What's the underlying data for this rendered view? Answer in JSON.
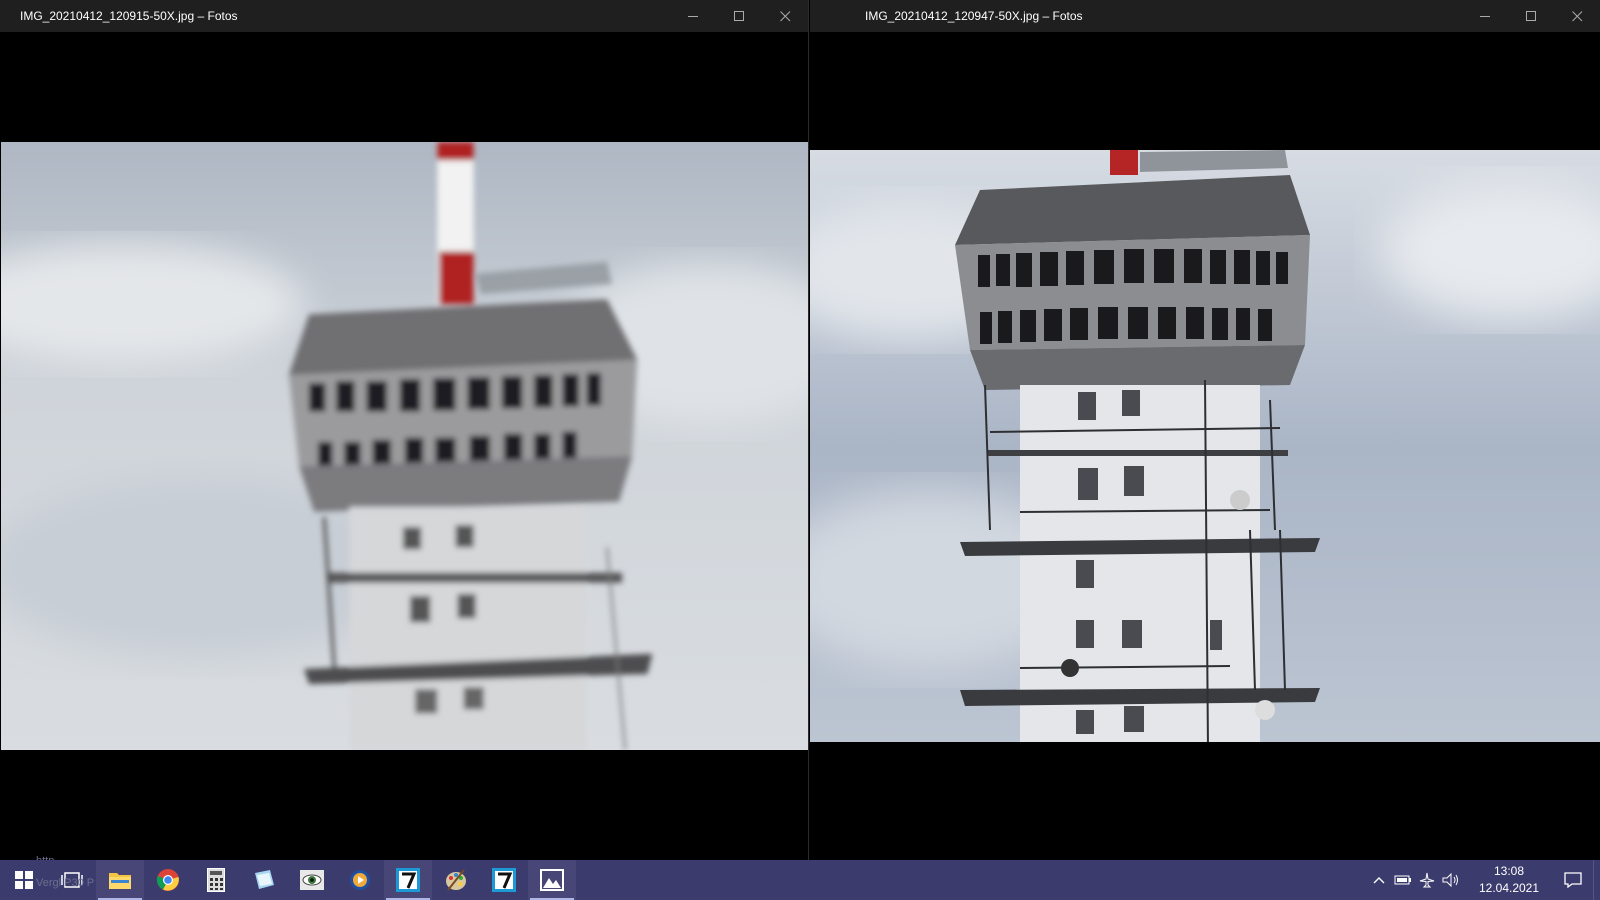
{
  "windows": {
    "left": {
      "title": "IMG_20210412_120915-50X.jpg – Fotos",
      "photo_alt": "blurry zoomed photo of a concrete TV tower top with red-white antenna"
    },
    "right": {
      "title": "IMG_20210412_120947-50X.jpg – Fotos",
      "photo_alt": "sharper zoomed photo of the same TV tower with balconies and ladders"
    }
  },
  "taskbar": {
    "ghost_text_1": "http",
    "ghost_text_2": "Vergl  P30 P",
    "apps": [
      {
        "name": "start-icon"
      },
      {
        "name": "task-view-icon"
      },
      {
        "name": "file-explorer-icon"
      },
      {
        "name": "chrome-icon"
      },
      {
        "name": "calculator-icon"
      },
      {
        "name": "notepad-icon"
      },
      {
        "name": "image-viewer-eye-icon"
      },
      {
        "name": "media-player-icon"
      },
      {
        "name": "photo-editor-icon"
      },
      {
        "name": "paint-icon"
      },
      {
        "name": "photo-editor-2-icon"
      },
      {
        "name": "photos-icon"
      }
    ],
    "clock": {
      "time": "13:08",
      "date": "12.04.2021"
    }
  },
  "colors": {
    "titlebar": "#1f1f1f",
    "taskbar": "#3c3b6e",
    "sky": "#c5ccd6"
  }
}
